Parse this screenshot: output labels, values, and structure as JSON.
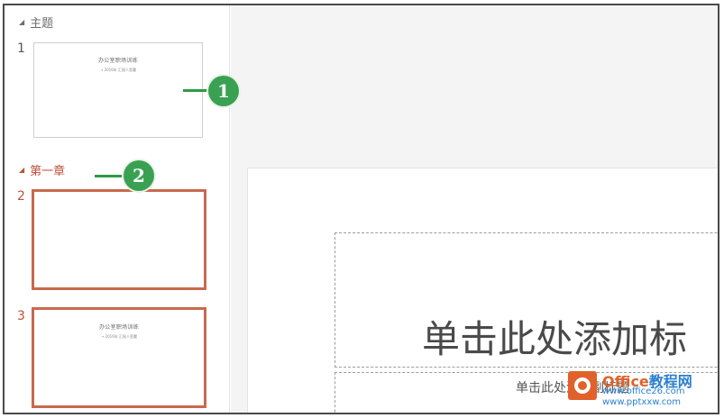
{
  "pane": {
    "sections": [
      {
        "label": "主题",
        "icon": "collapse-triangle-icon"
      },
      {
        "label": "第一章",
        "icon": "collapse-triangle-icon"
      }
    ],
    "slides": [
      {
        "number": "1",
        "title": "办公室职场训练",
        "subtitle": "→ 2016年 汇报人签署"
      },
      {
        "number": "2",
        "title": "",
        "subtitle": ""
      },
      {
        "number": "3",
        "title": "办公室职场训练",
        "subtitle": "→ 2016年 汇报人签署"
      }
    ]
  },
  "callouts": [
    "1",
    "2"
  ],
  "slide": {
    "title_placeholder": "单击此处添加标",
    "subtitle_placeholder": "单击此处添加副标题"
  },
  "watermark": {
    "brand_main": "Office",
    "brand_accent": "教程网",
    "url1": "www.office26.com",
    "url2": "www.pptxxw.com"
  },
  "colors": {
    "section_accent": "#c0503a",
    "selected_border": "#c86a4d",
    "callout": "#3aa153"
  }
}
